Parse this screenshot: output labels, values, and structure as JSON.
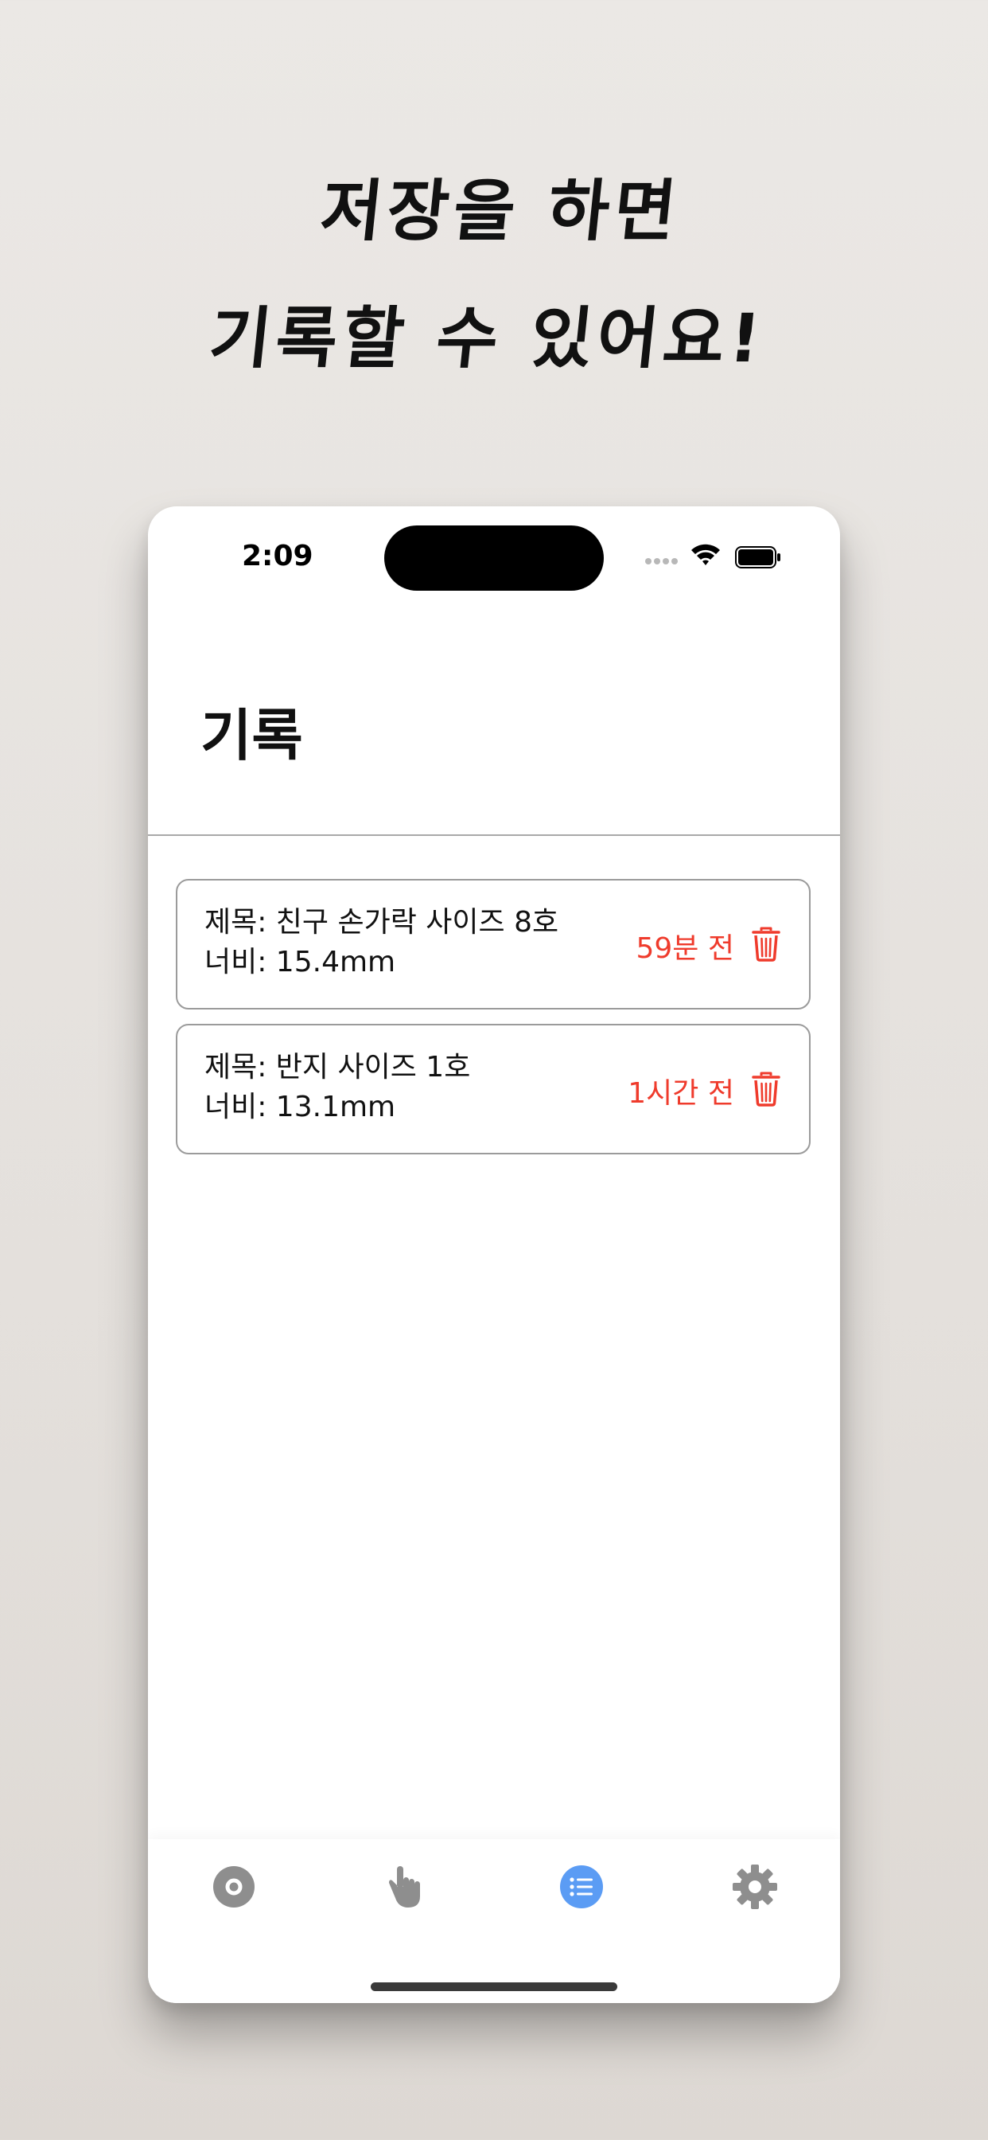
{
  "promo": {
    "line1": "저장을 하면",
    "line2": "기록할 수 있어요!"
  },
  "status_bar": {
    "time": "2:09"
  },
  "page": {
    "title": "기록"
  },
  "records": [
    {
      "title_line": "제목: 친구 손가락 사이즈 8호",
      "width_line": "너비: 15.4mm",
      "time_ago": "59분 전"
    },
    {
      "title_line": "제목: 반지 사이즈 1호",
      "width_line": "너비: 13.1mm",
      "time_ago": "1시간 전"
    }
  ],
  "tab_bar": {
    "items": [
      {
        "icon": "ring-icon",
        "selected": false
      },
      {
        "icon": "pointing-hand-icon",
        "selected": false
      },
      {
        "icon": "list-icon",
        "selected": true
      },
      {
        "icon": "gear-icon",
        "selected": false
      }
    ]
  },
  "colors": {
    "accent": "#5b9cf4",
    "danger": "#ef3b2c",
    "icon_inactive": "#8e8e8e",
    "card_border": "#9b9b9b"
  }
}
